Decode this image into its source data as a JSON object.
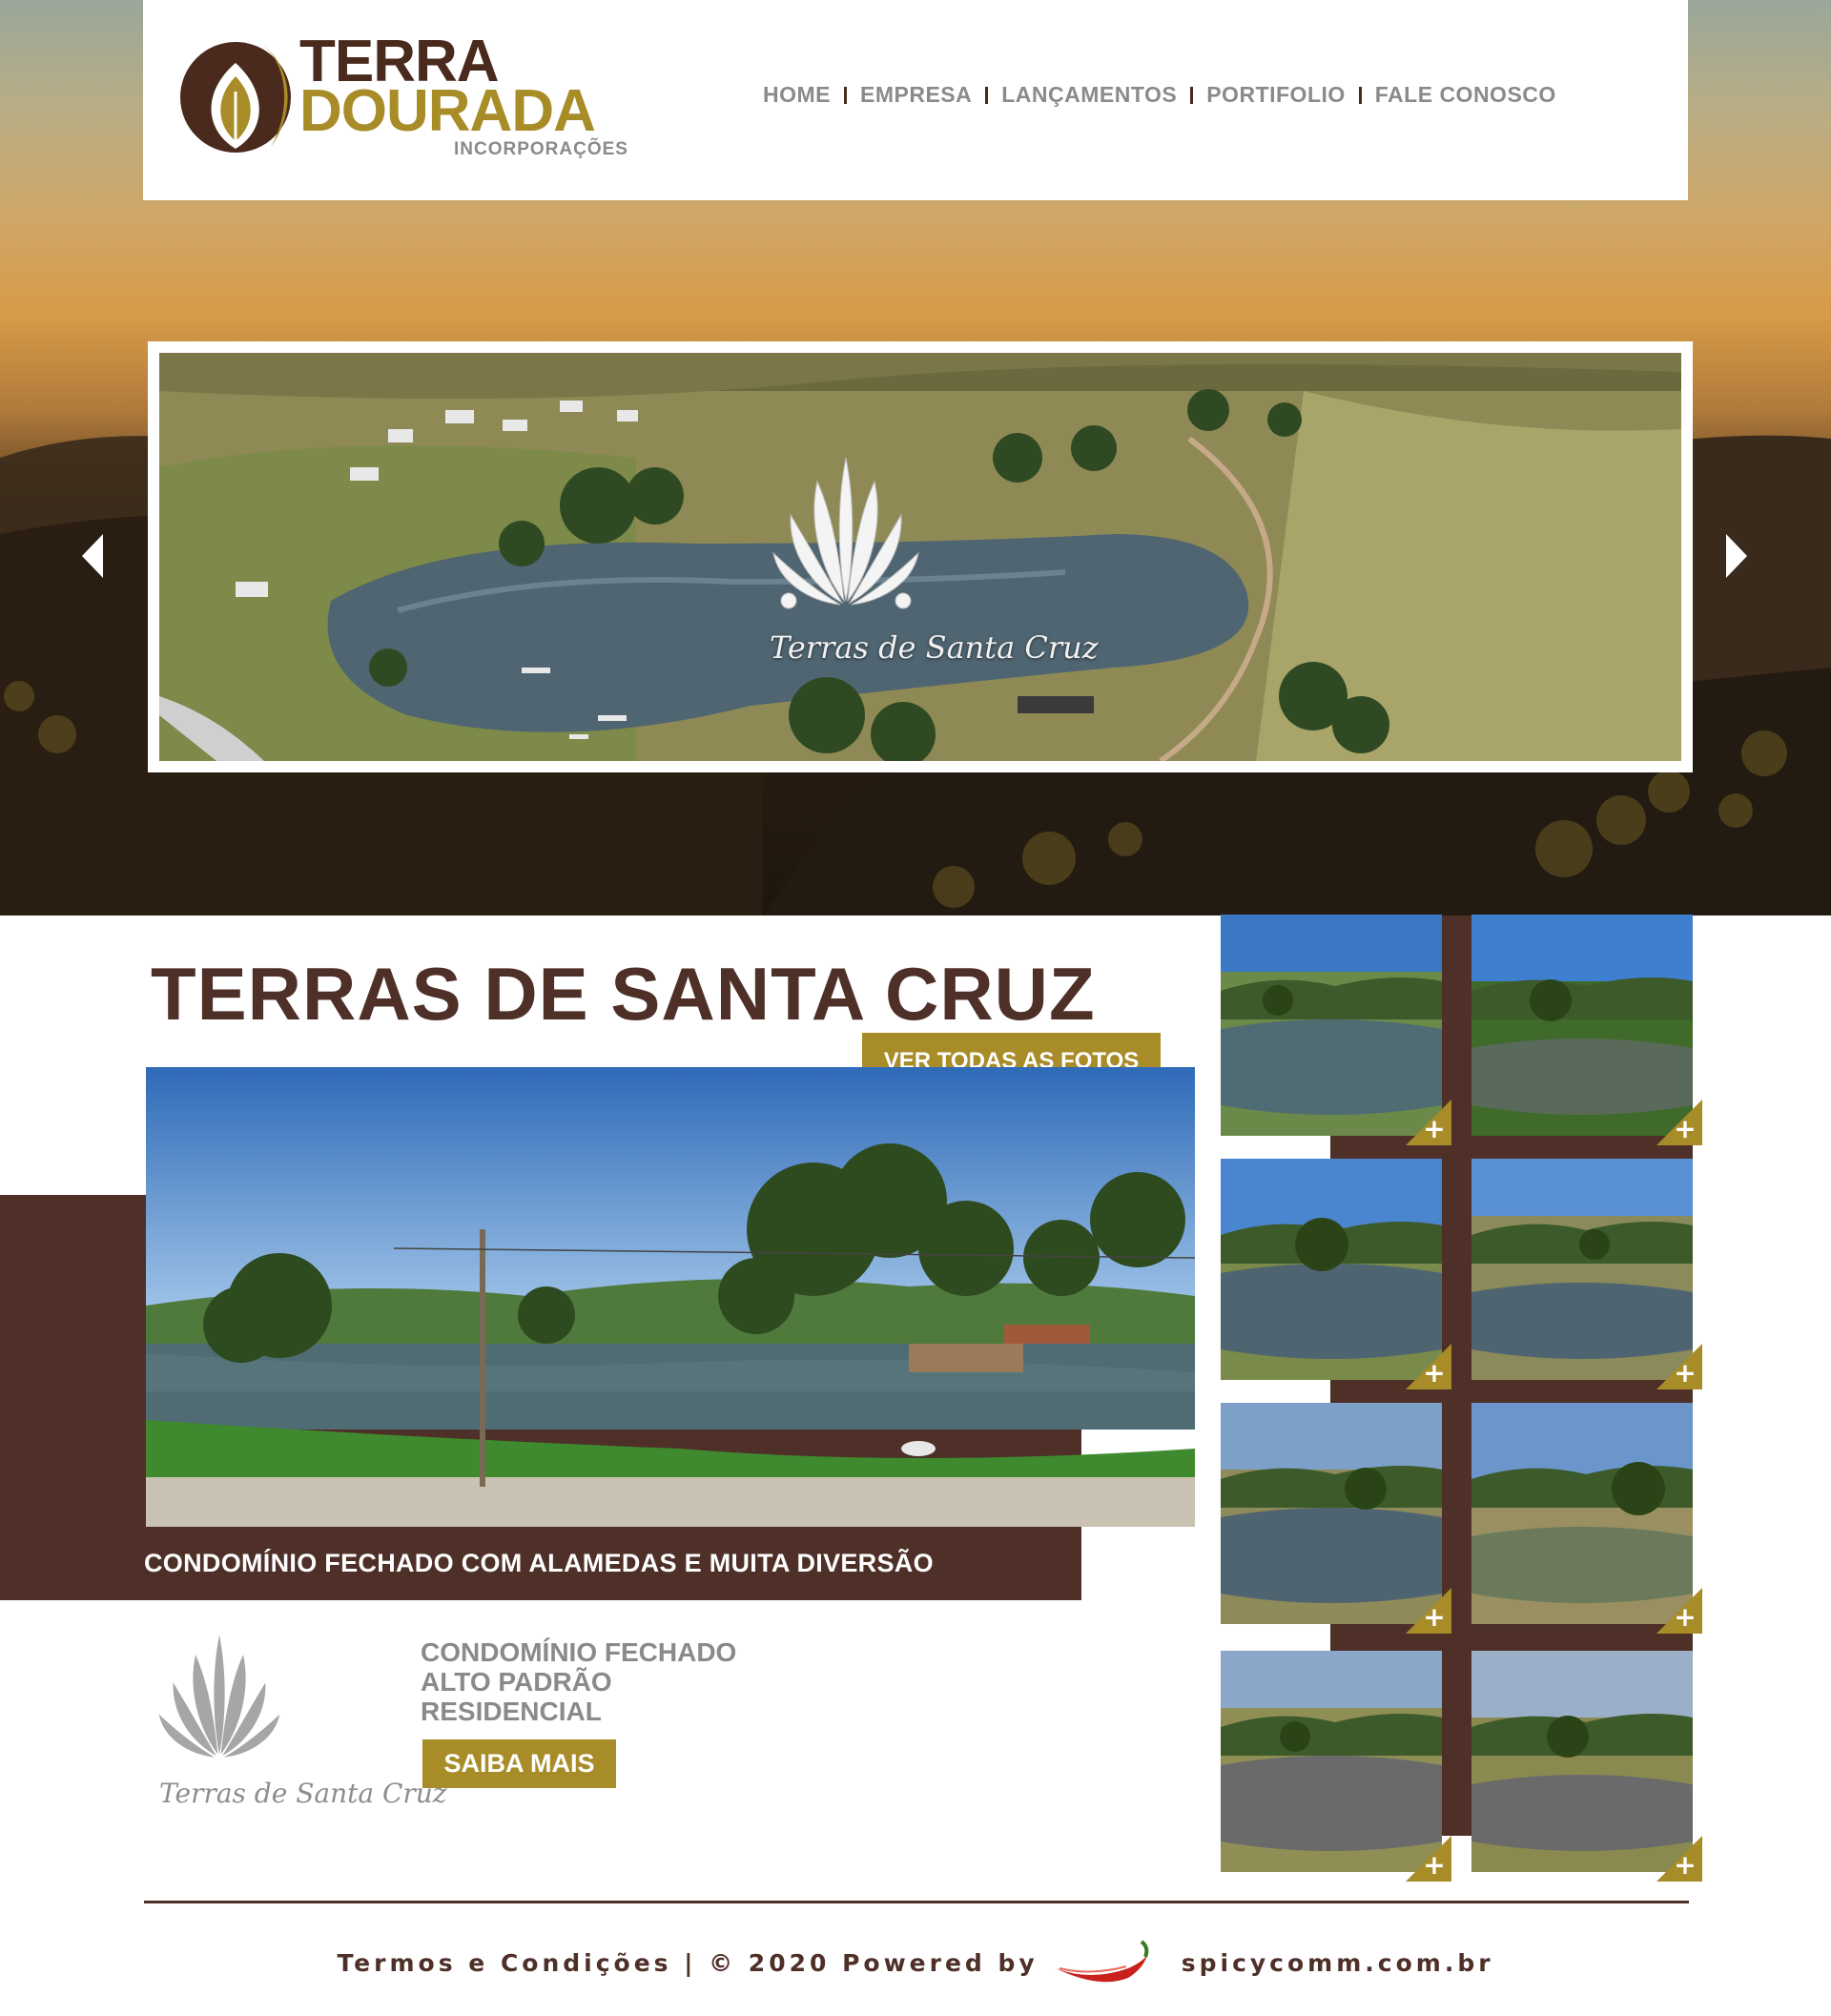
{
  "brand": {
    "name_line1": "TERRA",
    "name_line2": "DOURADA",
    "tagline": "INCORPORAÇÕES"
  },
  "nav": {
    "items": [
      "HOME",
      "EMPRESA",
      "LANÇAMENTOS",
      "PORTIFOLIO",
      "FALE CONOSCO"
    ]
  },
  "slider": {
    "logo_text": "Terras de Santa Cruz"
  },
  "project": {
    "title": "TERRAS DE SANTA CRUZ",
    "see_all_button": "VER TODAS AS FOTOS",
    "caption": "CONDOMÍNIO FECHADO COM ALAMEDAS E MUITA DIVERSÃO",
    "logo_text": "Terras de Santa Cruz",
    "desc_lines": [
      "CONDOMÍNIO FECHADO",
      "ALTO PADRÃO",
      "RESIDENCIAL"
    ],
    "more_button": "SAIBA MAIS"
  },
  "gallery": {
    "plus_symbol": "+",
    "thumb_count": 8
  },
  "footer": {
    "text": "Termos e Condições | © 2020 Powered by",
    "site": "spicycomm.com.br"
  },
  "colors": {
    "brown": "#4e3028",
    "gold": "#a88c27",
    "grey_text": "#8a8a8a"
  }
}
